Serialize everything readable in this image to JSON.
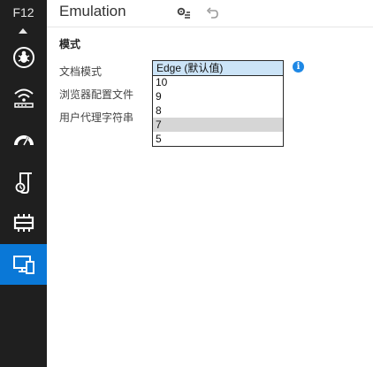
{
  "rail": {
    "title": "F12",
    "items": [
      {
        "name": "debugger-icon"
      },
      {
        "name": "network-icon"
      },
      {
        "name": "performance-icon"
      },
      {
        "name": "memory-icon"
      },
      {
        "name": "emulation-icon"
      },
      {
        "name": "display-icon"
      }
    ]
  },
  "header": {
    "title": "Emulation"
  },
  "section": {
    "title": "模式"
  },
  "labels": {
    "document_mode": "文档模式",
    "browser_profile": "浏览器配置文件",
    "user_agent": "用户代理字符串"
  },
  "dropdown": {
    "options": [
      "Edge (默认值)",
      "10",
      "9",
      "8",
      "7",
      "5"
    ],
    "selected_index": 0,
    "hover_index": 4
  },
  "info": {
    "glyph": "i"
  },
  "colors": {
    "rail_bg": "#1f1f1f",
    "active_item": "#0a78d7",
    "selected_option": "#cce4f7",
    "hover_option": "#d6d6d6",
    "info": "#1e88e5"
  }
}
